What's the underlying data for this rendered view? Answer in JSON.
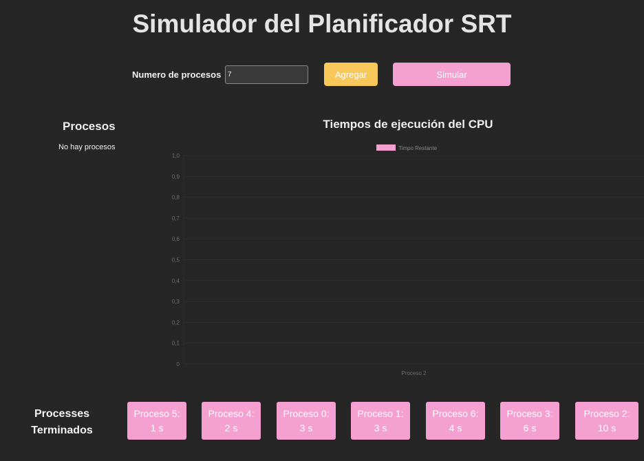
{
  "header": {
    "title": "Simulador del Planificador SRT"
  },
  "controls": {
    "count_label": "Numero de procesos",
    "count_value": "7",
    "add_label": "Agregar",
    "simulate_label": "Simular"
  },
  "procesos": {
    "heading": "Procesos",
    "empty_text": "No hay procesos"
  },
  "chart_data": {
    "type": "bar",
    "title": "Tiempos de ejecución del CPU",
    "categories": [
      "Proceso 2"
    ],
    "series": [
      {
        "name": "Timpo Restante",
        "values": [
          0
        ],
        "color": "#f4a0d0"
      }
    ],
    "ylim": [
      0,
      1
    ],
    "yticks": [
      "0",
      "0,1",
      "0,2",
      "0,3",
      "0,4",
      "0,5",
      "0,6",
      "0,7",
      "0,8",
      "0,9",
      "1,0"
    ],
    "grid": true,
    "legend": "top"
  },
  "finished": {
    "label_line1": "Processes",
    "label_line2": "Terminados",
    "items": [
      {
        "name": "Proceso 5:",
        "time": "1 s"
      },
      {
        "name": "Proceso 4:",
        "time": "2 s"
      },
      {
        "name": "Proceso 0:",
        "time": "3 s"
      },
      {
        "name": "Proceso 1:",
        "time": "3 s"
      },
      {
        "name": "Proceso 6:",
        "time": "4 s"
      },
      {
        "name": "Proceso 3:",
        "time": "6 s"
      },
      {
        "name": "Proceso 2:",
        "time": "10 s"
      }
    ]
  },
  "colors": {
    "background": "#262626",
    "accent_pink": "#f4a0d0",
    "accent_yellow": "#f8c85a"
  }
}
